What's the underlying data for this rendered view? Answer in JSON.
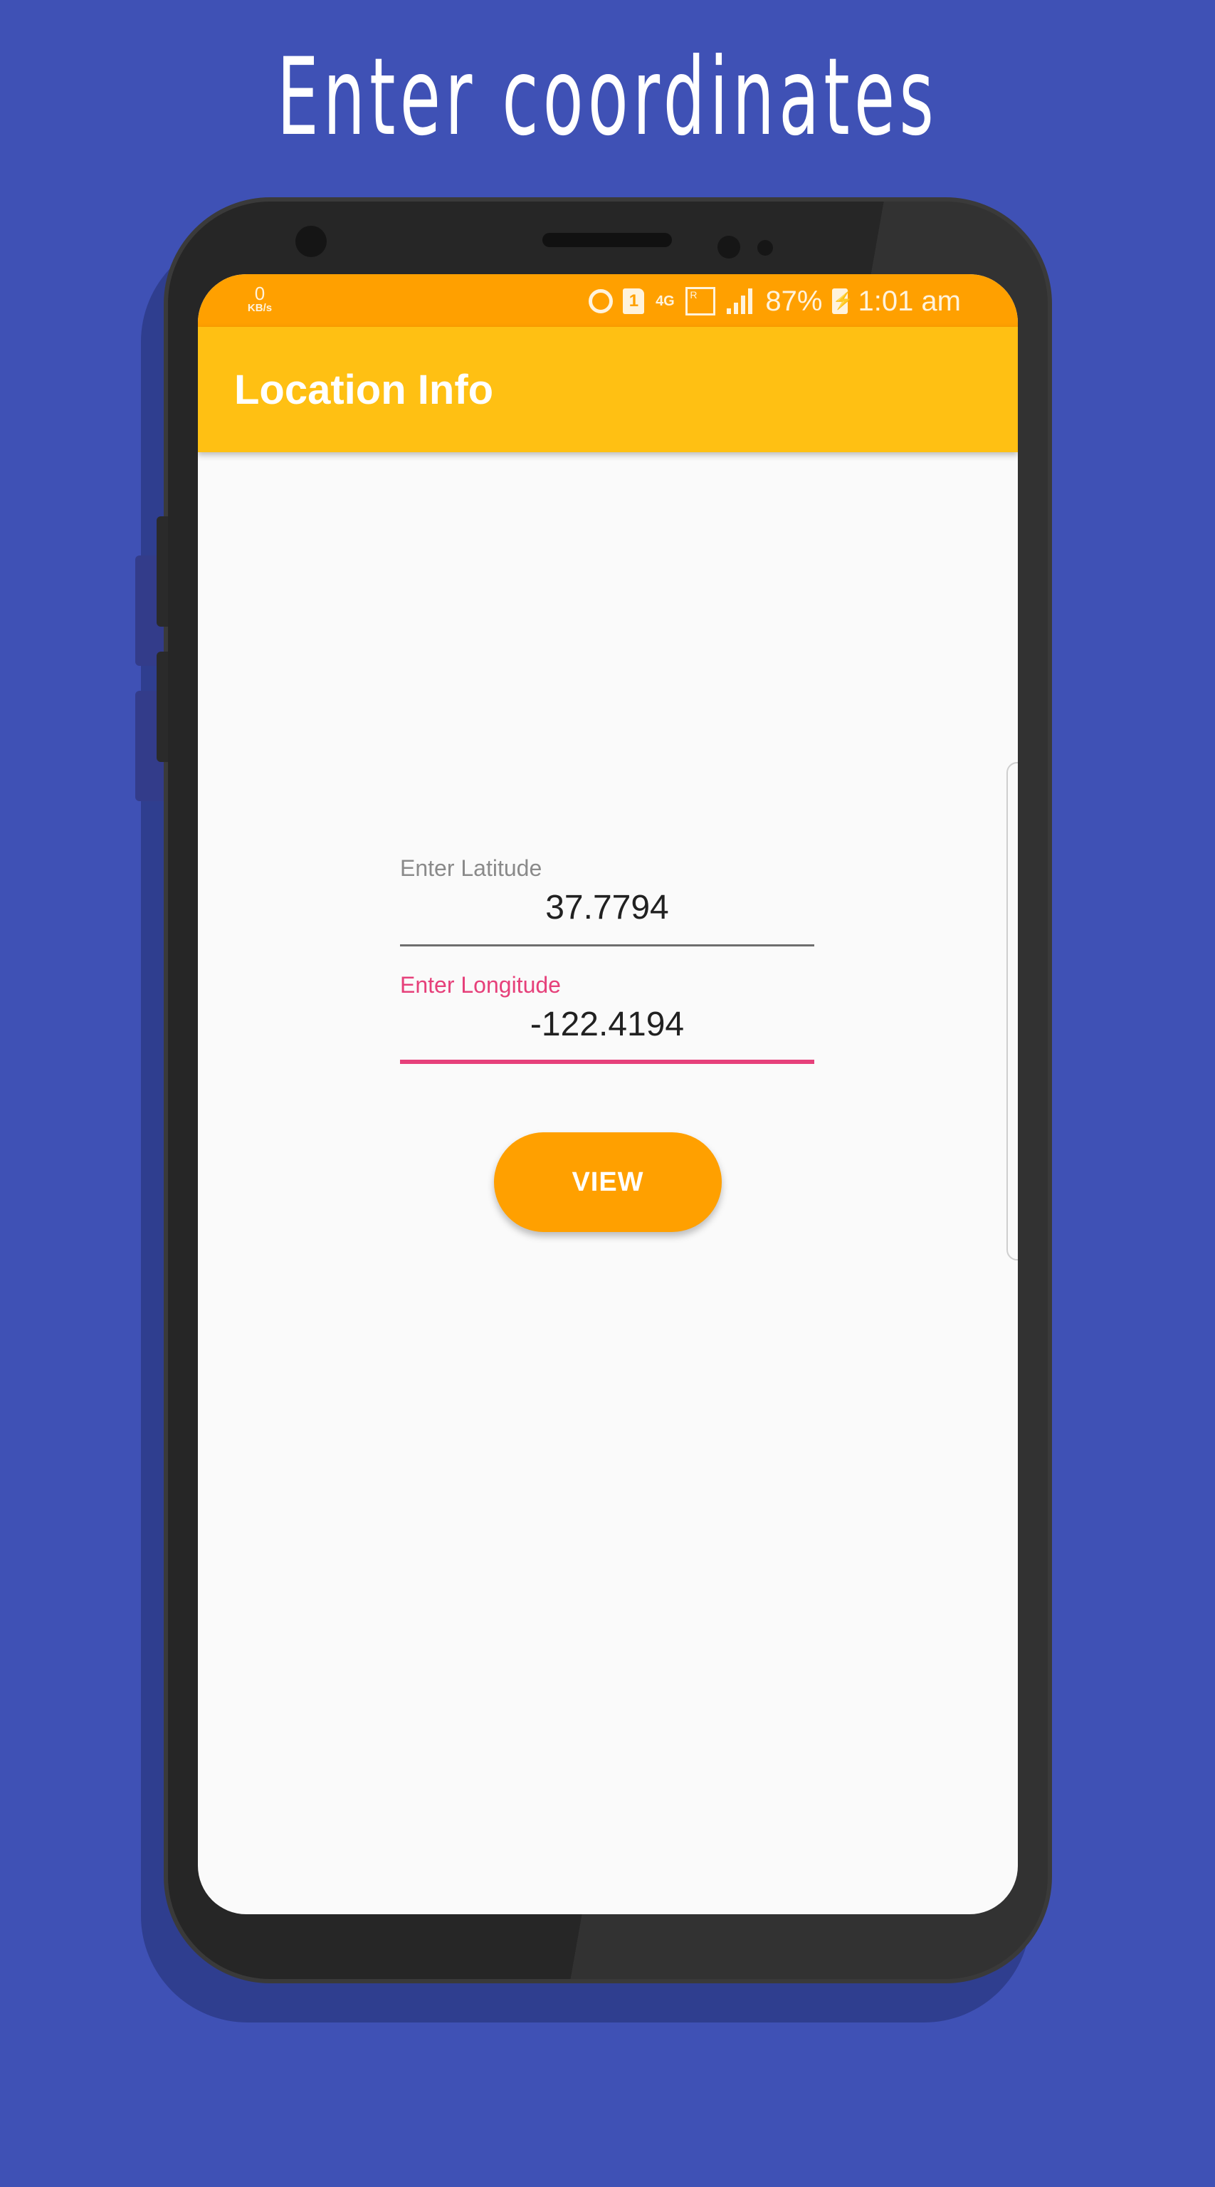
{
  "headline": "Enter coordinates",
  "statusbar": {
    "speed_value": "0",
    "speed_unit": "KB/s",
    "sim_slot": "1",
    "network_type": "4G",
    "roaming_label": "R",
    "battery": "87%",
    "time": "1:01 am",
    "icons": [
      "alarm-icon",
      "sim-icon",
      "4g-data-icon",
      "roaming-signal-icon",
      "signal-icon",
      "battery-charging-icon"
    ]
  },
  "appbar": {
    "title": "Location Info"
  },
  "form": {
    "latitude": {
      "label": "Enter Latitude",
      "value": "37.7794"
    },
    "longitude": {
      "label": "Enter Longitude",
      "value": "-122.4194"
    },
    "view_button": "VIEW"
  },
  "colors": {
    "background": "#3f51b5",
    "status_bar": "#ffa000",
    "app_bar": "#ffc013",
    "accent": "#e6407a",
    "button": "#ffa000"
  }
}
